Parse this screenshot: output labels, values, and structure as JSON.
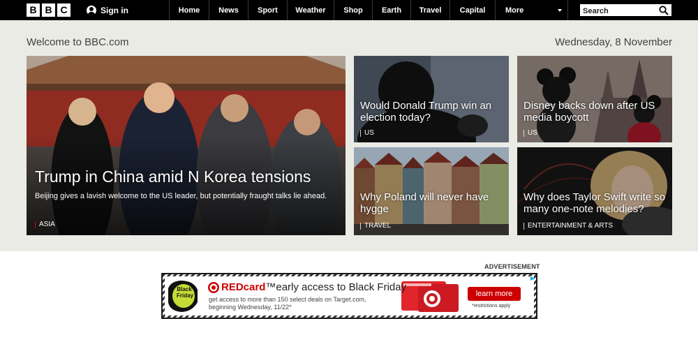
{
  "header": {
    "logo_letters": [
      "B",
      "B",
      "C"
    ],
    "signin_label": "Sign in",
    "nav": [
      "Home",
      "News",
      "Sport",
      "Weather",
      "Shop",
      "Earth",
      "Travel",
      "Capital"
    ],
    "more_label": "More",
    "search_placeholder": "Search"
  },
  "page": {
    "welcome": "Welcome to BBC.com",
    "date": "Wednesday, 8 November"
  },
  "stories": {
    "main": {
      "headline": "Trump in China amid N Korea tensions",
      "summary": "Beijing gives a lavish welcome to the US leader, but potentially fraught talks lie ahead.",
      "tag": "ASIA"
    },
    "s1": {
      "headline": "Would Donald Trump win an election today?",
      "tag": "US"
    },
    "s2": {
      "headline": "Disney backs down after US media boycott",
      "tag": "US"
    },
    "s3": {
      "headline": "Why Poland will never have hygge",
      "tag": "TRAVEL"
    },
    "s4": {
      "headline": "Why does Taylor Swift write so many one-note melodies?",
      "tag": "ENTERTAINMENT & ARTS"
    }
  },
  "ad": {
    "label": "ADVERTISEMENT",
    "badge_line1": "Black",
    "badge_line2": "Friday",
    "title_brand": "REDcard",
    "title_rest": "™early access to Black Friday",
    "body": "get access to more than 150 select deals on Target.com, beginning Wednesday, 11/22*",
    "cta": "learn more",
    "disclaimer": "*restrictions apply"
  },
  "colors": {
    "topbar": "#000000",
    "hero_bg": "#ebebe6",
    "tag_accent": "#e3001b",
    "target_red": "#cc0000",
    "badge_green": "#c6dc36"
  }
}
